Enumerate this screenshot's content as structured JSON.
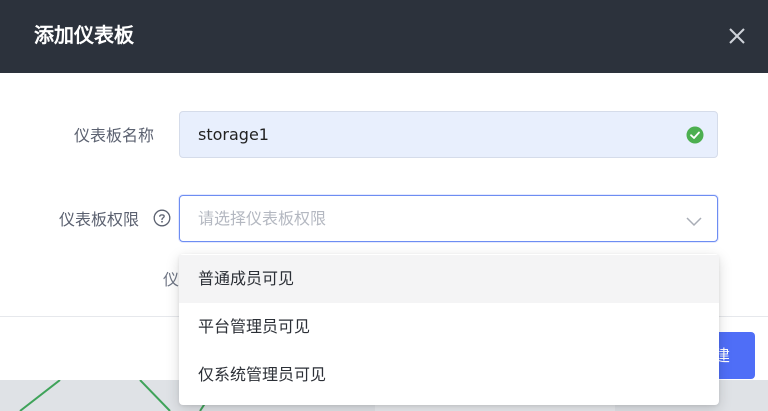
{
  "dialog": {
    "title": "添加仪表板",
    "close_icon": "close-icon"
  },
  "form": {
    "name_label": "仪表板名称",
    "name_value": "storage1",
    "name_valid_icon": "check-circle-icon",
    "permission_label": "仪表板权限",
    "permission_help_icon": "question-circle-icon",
    "permission_placeholder": "请选择仪表板权限",
    "permission_chevron_icon": "chevron-down-icon",
    "partial_label": "仪"
  },
  "dropdown": {
    "options": [
      {
        "label": "普通成员可见"
      },
      {
        "label": "平台管理员可见"
      },
      {
        "label": "仅系统管理员可见"
      }
    ]
  },
  "footer": {
    "create_label": "建"
  },
  "colors": {
    "header_bg": "#2c323c",
    "primary": "#4f6ef7",
    "success": "#52c41a",
    "input_fill": "#e8effd"
  }
}
